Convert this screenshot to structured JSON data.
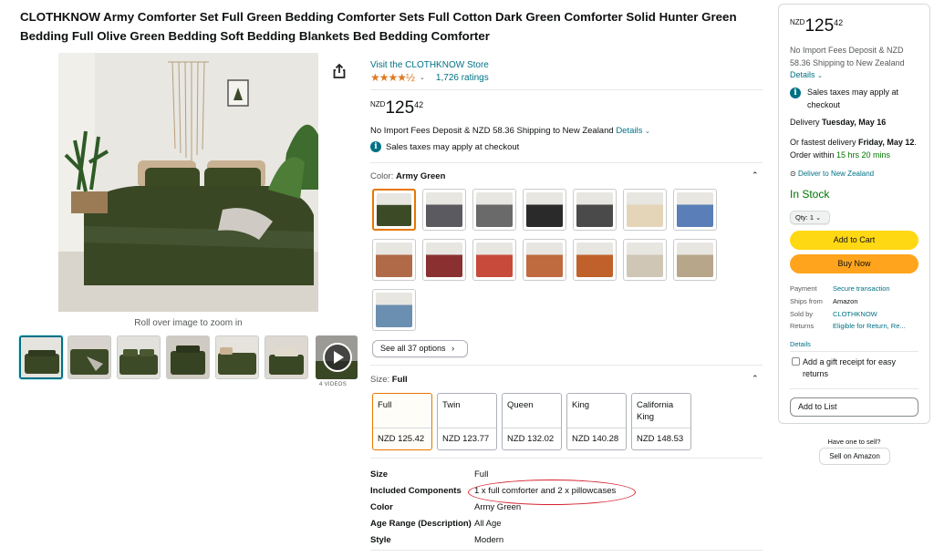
{
  "product": {
    "title": "CLOTHKNOW Army Comforter Set Full Green Bedding Comforter Sets Full Cotton Dark Green Comforter Solid Hunter Green Bedding Full Olive Green Bedding Soft Bedding Blankets Bed Bedding Comforter",
    "store_link": "Visit the CLOTHKNOW Store",
    "stars": "★★★★½",
    "ratings": "1,726 ratings",
    "zoom_hint": "Roll over image to zoom in",
    "videos_label": "4 VIDEOS"
  },
  "price": {
    "currency": "NZD",
    "whole": "125",
    "fraction": "42",
    "import_text": "No Import Fees Deposit & NZD 58.36 Shipping to New Zealand",
    "details_link": "Details",
    "tax_text": "Sales taxes may apply at checkout"
  },
  "color": {
    "label": "Color:",
    "selected": "Army Green",
    "see_all": "See all 37 options",
    "swatches": [
      "#3d4a26",
      "#5a5a60",
      "#6a6a6a",
      "#2a2a2a",
      "#4a4a4a",
      "#e4d4b8",
      "#5a7fb8",
      "#b06a48",
      "#8a3030",
      "#c84a3a",
      "#c06a40",
      "#c0602a",
      "#cfc6b6",
      "#b8a68a",
      "#6a8fb0"
    ]
  },
  "size": {
    "label": "Size:",
    "selected": "Full",
    "options": [
      {
        "name": "Full",
        "price": "NZD 125.42"
      },
      {
        "name": "Twin",
        "price": "NZD 123.77"
      },
      {
        "name": "Queen",
        "price": "NZD 132.02"
      },
      {
        "name": "King",
        "price": "NZD 140.28"
      },
      {
        "name": "California King",
        "price": "NZD 148.53"
      }
    ]
  },
  "specs": [
    {
      "key": "Size",
      "value": "Full"
    },
    {
      "key": "Included Components",
      "value": "1 x full comforter and 2 x pillowcases"
    },
    {
      "key": "Color",
      "value": "Army Green"
    },
    {
      "key": "Age Range (Description)",
      "value": "All Age"
    },
    {
      "key": "Style",
      "value": "Modern"
    }
  ],
  "buybox": {
    "currency": "NZD",
    "whole": "125",
    "fraction": "42",
    "shipping_text": "No Import Fees Deposit & NZD 58.36 Shipping to New Zealand",
    "details_link": "Details",
    "tax_text": "Sales taxes may apply at checkout",
    "delivery_prefix": "Delivery",
    "delivery_date": "Tuesday, May 16",
    "fastest_prefix": "Or fastest delivery",
    "fastest_date": "Friday, May 12",
    "order_within": ". Order within",
    "countdown": "15 hrs 20 mins",
    "deliver_to": "Deliver to New Zealand",
    "stock": "In Stock",
    "qty": "Qty: 1",
    "add_to_cart": "Add to Cart",
    "buy_now": "Buy Now",
    "info": [
      {
        "key": "Payment",
        "value": "Secure transaction"
      },
      {
        "key": "Ships from",
        "value": "Amazon"
      },
      {
        "key": "Sold by",
        "value": "CLOTHKNOW"
      },
      {
        "key": "Returns",
        "value": "Eligible for Return, Re..."
      }
    ],
    "details": "Details",
    "gift": "Add a gift receipt for easy returns",
    "add_to_list": "Add to List",
    "sell_question": "Have one to sell?",
    "sell_button": "Sell on Amazon"
  },
  "colors": {
    "link": "#007185",
    "stars": "#de7921",
    "cart": "#ffd814",
    "buy": "#ffa41c",
    "stock": "#007600",
    "selected_border": "#e77600",
    "highlight": "#d6202f"
  }
}
